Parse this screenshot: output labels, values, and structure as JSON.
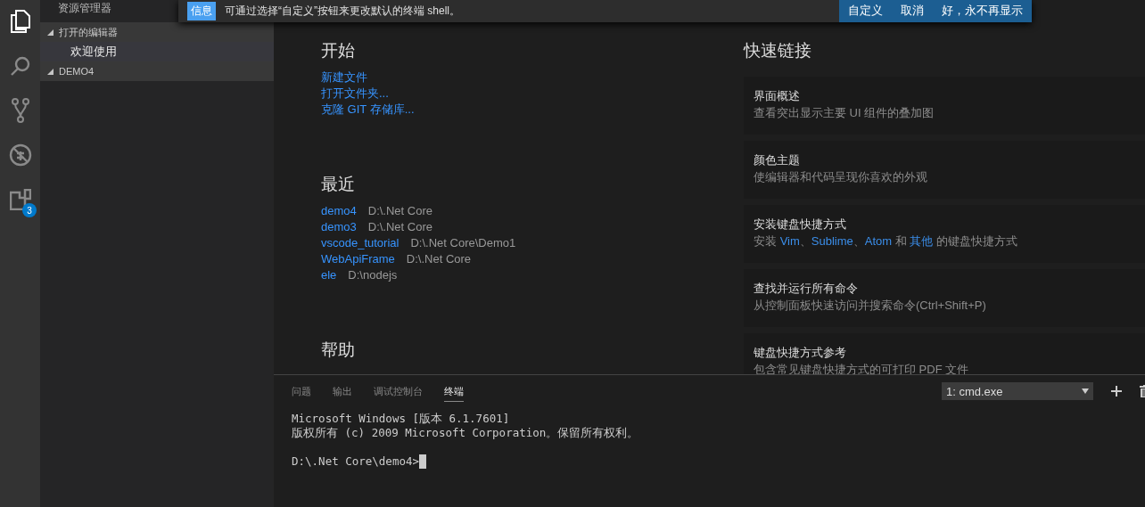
{
  "activity_bar": {
    "items": [
      {
        "kind": "files",
        "selected": true
      },
      {
        "kind": "search",
        "selected": false
      },
      {
        "kind": "git",
        "selected": false
      },
      {
        "kind": "debug",
        "selected": false
      },
      {
        "kind": "extensions",
        "selected": false,
        "badge": "3"
      }
    ]
  },
  "sidebar": {
    "title": "资源管理器",
    "sections": [
      {
        "label": "打开的编辑器",
        "expanded": true,
        "items": [
          {
            "label": "欢迎使用",
            "selected": true
          }
        ]
      },
      {
        "label": "DEMO4",
        "expanded": true
      }
    ]
  },
  "notification": {
    "badge": "信息",
    "message": "可通过选择“自定义”按钮来更改默认的终端 shell。",
    "buttons": [
      "自定义",
      "取消",
      "好，永不再显示"
    ]
  },
  "welcome": {
    "start": {
      "title": "开始",
      "links": [
        "新建文件",
        "打开文件夹...",
        "克隆 GIT 存储库..."
      ]
    },
    "recent": {
      "title": "最近",
      "items": [
        {
          "name": "demo4",
          "path": "D:\\.Net Core"
        },
        {
          "name": "demo3",
          "path": "D:\\.Net Core"
        },
        {
          "name": "vscode_tutorial",
          "path": "D:\\.Net Core\\Demo1"
        },
        {
          "name": "WebApiFrame",
          "path": "D:\\.Net Core"
        },
        {
          "name": "ele",
          "path": "D:\\nodejs"
        }
      ]
    },
    "help": {
      "title": "帮助"
    },
    "quick_links": {
      "title": "快速链接",
      "cards": [
        {
          "title": "界面概述",
          "description": [
            {
              "text": "查看突出显示主要 UI 组件的叠加图",
              "link": false
            }
          ]
        },
        {
          "title": "颜色主题",
          "description": [
            {
              "text": "使编辑器和代码呈现你喜欢的外观",
              "link": false
            }
          ]
        },
        {
          "title": "安装键盘快捷方式",
          "description": [
            {
              "text": "安装 ",
              "link": false
            },
            {
              "text": "Vim",
              "link": true
            },
            {
              "text": "、",
              "link": false
            },
            {
              "text": "Sublime",
              "link": true
            },
            {
              "text": "、",
              "link": false
            },
            {
              "text": "Atom",
              "link": true
            },
            {
              "text": " 和 ",
              "link": false
            },
            {
              "text": "其他",
              "link": true
            },
            {
              "text": " 的键盘快捷方式",
              "link": false
            }
          ]
        },
        {
          "title": "查找并运行所有命令",
          "description": [
            {
              "text": "从控制面板快速访问并搜索命令(Ctrl+Shift+P)",
              "link": false
            }
          ]
        },
        {
          "title": "键盘快捷方式参考",
          "description": [
            {
              "text": "包含常见键盘快捷方式的可打印 PDF 文件",
              "link": false
            }
          ]
        }
      ]
    }
  },
  "panel": {
    "tabs": [
      {
        "label": "问题",
        "selected": false
      },
      {
        "label": "输出",
        "selected": false
      },
      {
        "label": "调试控制台",
        "selected": false
      },
      {
        "label": "终端",
        "selected": true
      }
    ],
    "terminal_select": {
      "value": "1: cmd.exe"
    },
    "terminal_lines": [
      "Microsoft Windows [版本 6.1.7601]",
      "版权所有 (c) 2009 Microsoft Corporation。保留所有权利。"
    ],
    "terminal_prompt": "D:\\.Net Core\\demo4>"
  }
}
